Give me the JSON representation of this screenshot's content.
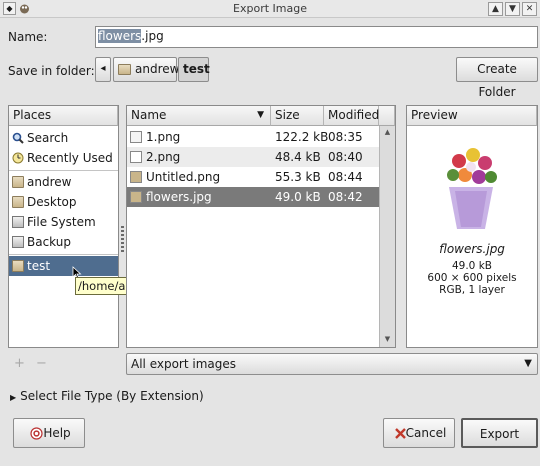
{
  "window": {
    "title": "Export Image",
    "menu_glyph": "◆",
    "controls": [
      "▲",
      "▼",
      "✕"
    ]
  },
  "name_row": {
    "label": "Name:",
    "value_selected": "flowers",
    "value_rest": ".jpg"
  },
  "folder_row": {
    "label": "Save in folder:",
    "back_arrow": "◂",
    "crumbs": [
      "andrew",
      "test"
    ],
    "create_folder": "Create Folder"
  },
  "places": {
    "header": "Places",
    "items": [
      {
        "label": "Search",
        "icon": "search-icon"
      },
      {
        "label": "Recently Used",
        "icon": "clock-icon"
      },
      {
        "label": "andrew",
        "icon": "folder-icon"
      },
      {
        "label": "Desktop",
        "icon": "folder-icon"
      },
      {
        "label": "File System",
        "icon": "drive-icon"
      },
      {
        "label": "Backup",
        "icon": "drive-icon"
      },
      {
        "label": "test",
        "icon": "folder-icon"
      }
    ],
    "add_glyph": "+",
    "remove_glyph": "−",
    "tooltip": "/home/andrew/test"
  },
  "files": {
    "columns": {
      "name": "Name",
      "size": "Size",
      "modified": "Modified"
    },
    "rows": [
      {
        "name": "1.png",
        "size": "122.2 kB",
        "modified": "08:35"
      },
      {
        "name": "2.png",
        "size": "48.4 kB",
        "modified": "08:40"
      },
      {
        "name": "Untitled.png",
        "size": "55.3 kB",
        "modified": "08:44"
      },
      {
        "name": "flowers.jpg",
        "size": "49.0 kB",
        "modified": "08:42"
      }
    ],
    "filter": "All export images"
  },
  "preview": {
    "header": "Preview",
    "filename": "flowers.jpg",
    "size": "49.0 kB",
    "dimensions": "600 × 600 pixels",
    "mode": "RGB, 1 layer"
  },
  "file_type": {
    "label": "Select File Type (By Extension)"
  },
  "buttons": {
    "help": "Help",
    "cancel": "Cancel",
    "export": "Export"
  },
  "colors": {
    "selection": "#7e8fa4",
    "file_selection": "#7a7a7a",
    "row_alt": "#ececec",
    "tooltip_bg": "#ffffcc"
  }
}
